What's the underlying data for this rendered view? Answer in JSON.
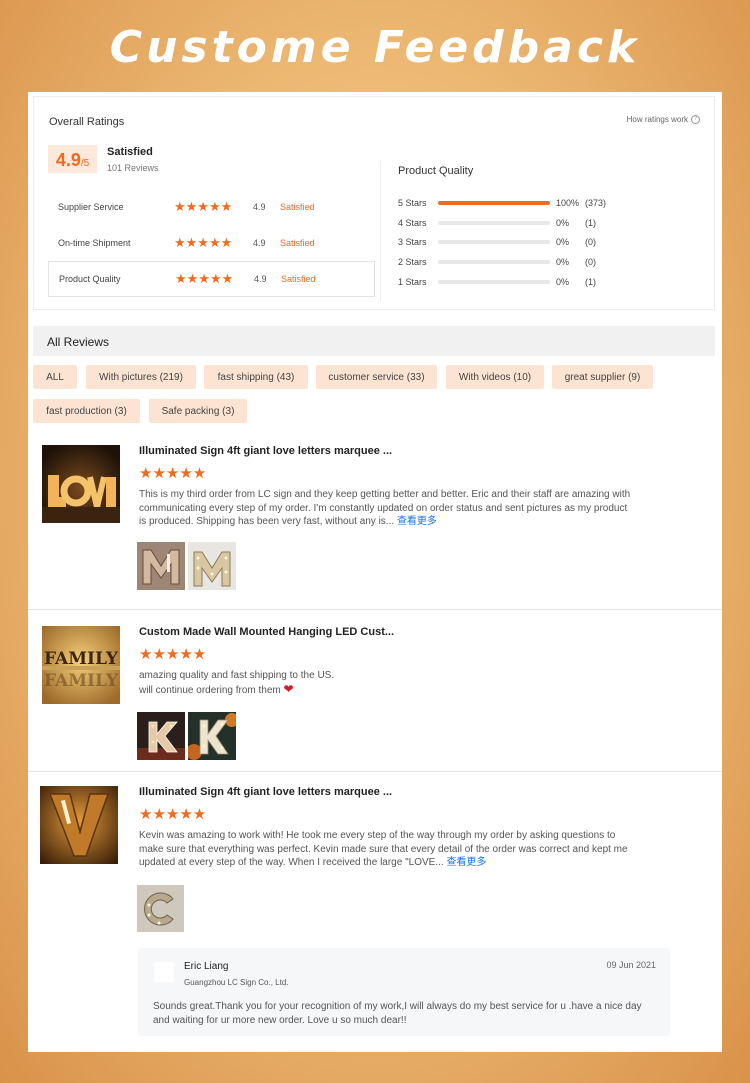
{
  "banner": {
    "title": "Custome Feedback"
  },
  "ratings": {
    "overall_title": "Overall Ratings",
    "how_ratings_work": "How ratings work",
    "score": "4.9",
    "score_suffix": "/5",
    "overall_label": "Satisfied",
    "reviews_count": "101 Reviews",
    "dimensions": [
      {
        "name": "Supplier Service",
        "stars": "★★★★★",
        "score": "4.9",
        "status": "Satisfied"
      },
      {
        "name": "On-time Shipment",
        "stars": "★★★★★",
        "score": "4.9",
        "status": "Satisfied"
      },
      {
        "name": "Product Quality",
        "stars": "★★★★★",
        "score": "4.9",
        "status": "Satisfied"
      }
    ],
    "product_quality_title": "Product Quality",
    "distribution": [
      {
        "label": "5 Stars",
        "percent": 100,
        "percent_text": "100%",
        "count": "(373)"
      },
      {
        "label": "4 Stars",
        "percent": 0,
        "percent_text": "0%",
        "count": "(1)"
      },
      {
        "label": "3 Stars",
        "percent": 0,
        "percent_text": "0%",
        "count": "(0)"
      },
      {
        "label": "2 Stars",
        "percent": 0,
        "percent_text": "0%",
        "count": "(0)"
      },
      {
        "label": "1 Stars",
        "percent": 0,
        "percent_text": "0%",
        "count": "(1)"
      }
    ]
  },
  "all_reviews": {
    "title": "All Reviews",
    "filters": [
      "ALL",
      "With pictures (219)",
      "fast shipping (43)",
      "customer service (33)",
      "With videos (10)",
      "great supplier (9)",
      "fast production (3)",
      "Safe packing (3)"
    ]
  },
  "reviews": [
    {
      "product_title": "Illuminated Sign 4ft giant love letters marquee ...",
      "stars": "★★★★★",
      "text": "This is my third order from LC sign and they keep getting better and better. Eric and their staff are amazing with communicating every step of my order. I'm constantly updated on order status and sent pictures as my product is produced. Shipping has been very fast, without any is...",
      "more": "查看更多",
      "image_icon": "love-marquee-letters-image"
    },
    {
      "product_title": "Custom Made Wall Mounted Hanging LED Cust...",
      "stars": "★★★★★",
      "text_line1": "amazing quality and fast shipping to the US.",
      "text_line2": "will continue ordering from them",
      "heart": "❤",
      "image_icon": "family-marquee-sign-image"
    },
    {
      "product_title": "Illuminated Sign 4ft giant love letters marquee ...",
      "stars": "★★★★★",
      "text": "Kevin was amazing to work with! He took me every step of the way through my order by asking questions to make sure that everything was perfect. Kevin made sure that every detail of the order was correct and kept me updated at every step of the way. When I received the large \"LOVE...",
      "more": "查看更多",
      "image_icon": "v-marquee-letter-image",
      "reply": {
        "name": "Eric Liang",
        "company": "Guangzhou LC Sign Co., Ltd.",
        "date": "09 Jun 2021",
        "text": "Sounds great.Thank you for your recognition of my work,I will always do my best service for u .have a nice day and waiting for ur  more new order. Love u so much dear!!"
      }
    }
  ],
  "colors": {
    "accent": "#f06a1f",
    "chip_bg": "#fde3d1",
    "link": "#1a73e8"
  }
}
